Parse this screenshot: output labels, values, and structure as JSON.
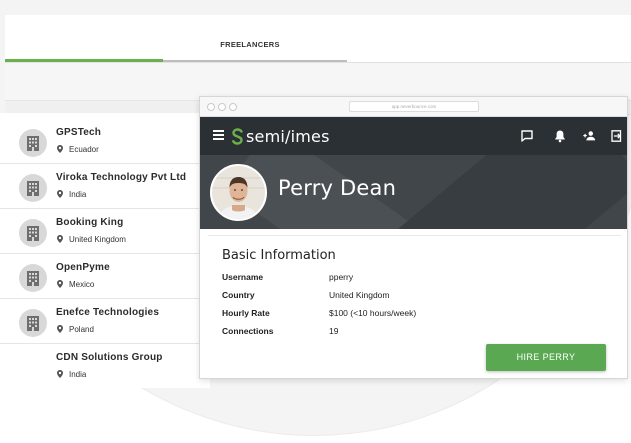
{
  "tabs": {
    "freelancers_label": "FREELANCERS"
  },
  "companies": [
    {
      "name": "GPSTech",
      "location": "Ecuador"
    },
    {
      "name": "Viroka Technology Pvt Ltd",
      "location": "India"
    },
    {
      "name": "Booking King",
      "location": "United Kingdom"
    },
    {
      "name": "OpenPyme",
      "location": "Mexico"
    },
    {
      "name": "Enefce Technologies",
      "location": "Poland"
    },
    {
      "name": "CDN Solutions Group",
      "location": "India"
    }
  ],
  "browser": {
    "url": "app.neverbounce.com"
  },
  "navbar": {
    "logo_text": "semi/imes",
    "icons": [
      "chat-icon",
      "bell-icon",
      "add-person-icon",
      "logout-icon"
    ]
  },
  "profile": {
    "name": "Perry Dean"
  },
  "basic_info": {
    "title": "Basic Information",
    "rows": [
      {
        "label": "Username",
        "value": "pperry"
      },
      {
        "label": "Country",
        "value": "United Kingdom"
      },
      {
        "label": "Hourly Rate",
        "value": "$100 (<10 hours/week)"
      },
      {
        "label": "Connections",
        "value": "19"
      }
    ]
  },
  "hire_button": {
    "label": "HIRE PERRY"
  },
  "colors": {
    "accent_green": "#5aa852",
    "navbar": "#2b3034",
    "header": "#41464b",
    "logo_green": "#6ab04c"
  }
}
